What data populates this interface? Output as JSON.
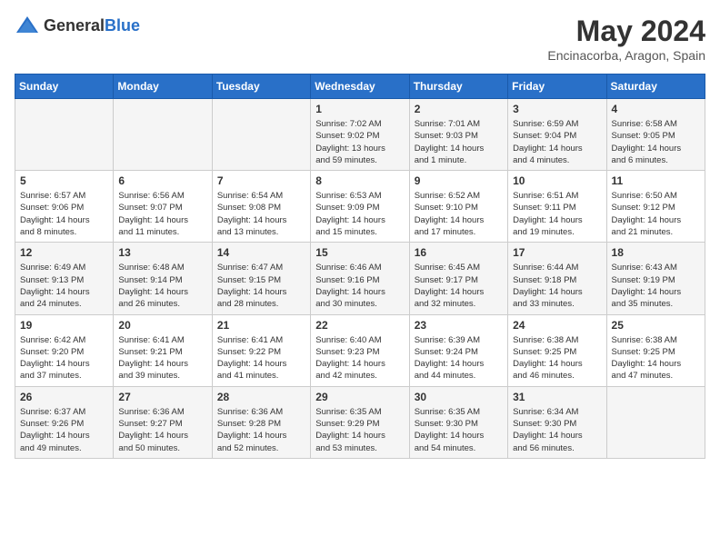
{
  "header": {
    "logo_general": "General",
    "logo_blue": "Blue",
    "month": "May 2024",
    "location": "Encinacorba, Aragon, Spain"
  },
  "days_of_week": [
    "Sunday",
    "Monday",
    "Tuesday",
    "Wednesday",
    "Thursday",
    "Friday",
    "Saturday"
  ],
  "weeks": [
    [
      {
        "day": "",
        "info": ""
      },
      {
        "day": "",
        "info": ""
      },
      {
        "day": "",
        "info": ""
      },
      {
        "day": "1",
        "info": "Sunrise: 7:02 AM\nSunset: 9:02 PM\nDaylight: 13 hours\nand 59 minutes."
      },
      {
        "day": "2",
        "info": "Sunrise: 7:01 AM\nSunset: 9:03 PM\nDaylight: 14 hours\nand 1 minute."
      },
      {
        "day": "3",
        "info": "Sunrise: 6:59 AM\nSunset: 9:04 PM\nDaylight: 14 hours\nand 4 minutes."
      },
      {
        "day": "4",
        "info": "Sunrise: 6:58 AM\nSunset: 9:05 PM\nDaylight: 14 hours\nand 6 minutes."
      }
    ],
    [
      {
        "day": "5",
        "info": "Sunrise: 6:57 AM\nSunset: 9:06 PM\nDaylight: 14 hours\nand 8 minutes."
      },
      {
        "day": "6",
        "info": "Sunrise: 6:56 AM\nSunset: 9:07 PM\nDaylight: 14 hours\nand 11 minutes."
      },
      {
        "day": "7",
        "info": "Sunrise: 6:54 AM\nSunset: 9:08 PM\nDaylight: 14 hours\nand 13 minutes."
      },
      {
        "day": "8",
        "info": "Sunrise: 6:53 AM\nSunset: 9:09 PM\nDaylight: 14 hours\nand 15 minutes."
      },
      {
        "day": "9",
        "info": "Sunrise: 6:52 AM\nSunset: 9:10 PM\nDaylight: 14 hours\nand 17 minutes."
      },
      {
        "day": "10",
        "info": "Sunrise: 6:51 AM\nSunset: 9:11 PM\nDaylight: 14 hours\nand 19 minutes."
      },
      {
        "day": "11",
        "info": "Sunrise: 6:50 AM\nSunset: 9:12 PM\nDaylight: 14 hours\nand 21 minutes."
      }
    ],
    [
      {
        "day": "12",
        "info": "Sunrise: 6:49 AM\nSunset: 9:13 PM\nDaylight: 14 hours\nand 24 minutes."
      },
      {
        "day": "13",
        "info": "Sunrise: 6:48 AM\nSunset: 9:14 PM\nDaylight: 14 hours\nand 26 minutes."
      },
      {
        "day": "14",
        "info": "Sunrise: 6:47 AM\nSunset: 9:15 PM\nDaylight: 14 hours\nand 28 minutes."
      },
      {
        "day": "15",
        "info": "Sunrise: 6:46 AM\nSunset: 9:16 PM\nDaylight: 14 hours\nand 30 minutes."
      },
      {
        "day": "16",
        "info": "Sunrise: 6:45 AM\nSunset: 9:17 PM\nDaylight: 14 hours\nand 32 minutes."
      },
      {
        "day": "17",
        "info": "Sunrise: 6:44 AM\nSunset: 9:18 PM\nDaylight: 14 hours\nand 33 minutes."
      },
      {
        "day": "18",
        "info": "Sunrise: 6:43 AM\nSunset: 9:19 PM\nDaylight: 14 hours\nand 35 minutes."
      }
    ],
    [
      {
        "day": "19",
        "info": "Sunrise: 6:42 AM\nSunset: 9:20 PM\nDaylight: 14 hours\nand 37 minutes."
      },
      {
        "day": "20",
        "info": "Sunrise: 6:41 AM\nSunset: 9:21 PM\nDaylight: 14 hours\nand 39 minutes."
      },
      {
        "day": "21",
        "info": "Sunrise: 6:41 AM\nSunset: 9:22 PM\nDaylight: 14 hours\nand 41 minutes."
      },
      {
        "day": "22",
        "info": "Sunrise: 6:40 AM\nSunset: 9:23 PM\nDaylight: 14 hours\nand 42 minutes."
      },
      {
        "day": "23",
        "info": "Sunrise: 6:39 AM\nSunset: 9:24 PM\nDaylight: 14 hours\nand 44 minutes."
      },
      {
        "day": "24",
        "info": "Sunrise: 6:38 AM\nSunset: 9:25 PM\nDaylight: 14 hours\nand 46 minutes."
      },
      {
        "day": "25",
        "info": "Sunrise: 6:38 AM\nSunset: 9:25 PM\nDaylight: 14 hours\nand 47 minutes."
      }
    ],
    [
      {
        "day": "26",
        "info": "Sunrise: 6:37 AM\nSunset: 9:26 PM\nDaylight: 14 hours\nand 49 minutes."
      },
      {
        "day": "27",
        "info": "Sunrise: 6:36 AM\nSunset: 9:27 PM\nDaylight: 14 hours\nand 50 minutes."
      },
      {
        "day": "28",
        "info": "Sunrise: 6:36 AM\nSunset: 9:28 PM\nDaylight: 14 hours\nand 52 minutes."
      },
      {
        "day": "29",
        "info": "Sunrise: 6:35 AM\nSunset: 9:29 PM\nDaylight: 14 hours\nand 53 minutes."
      },
      {
        "day": "30",
        "info": "Sunrise: 6:35 AM\nSunset: 9:30 PM\nDaylight: 14 hours\nand 54 minutes."
      },
      {
        "day": "31",
        "info": "Sunrise: 6:34 AM\nSunset: 9:30 PM\nDaylight: 14 hours\nand 56 minutes."
      },
      {
        "day": "",
        "info": ""
      }
    ]
  ]
}
